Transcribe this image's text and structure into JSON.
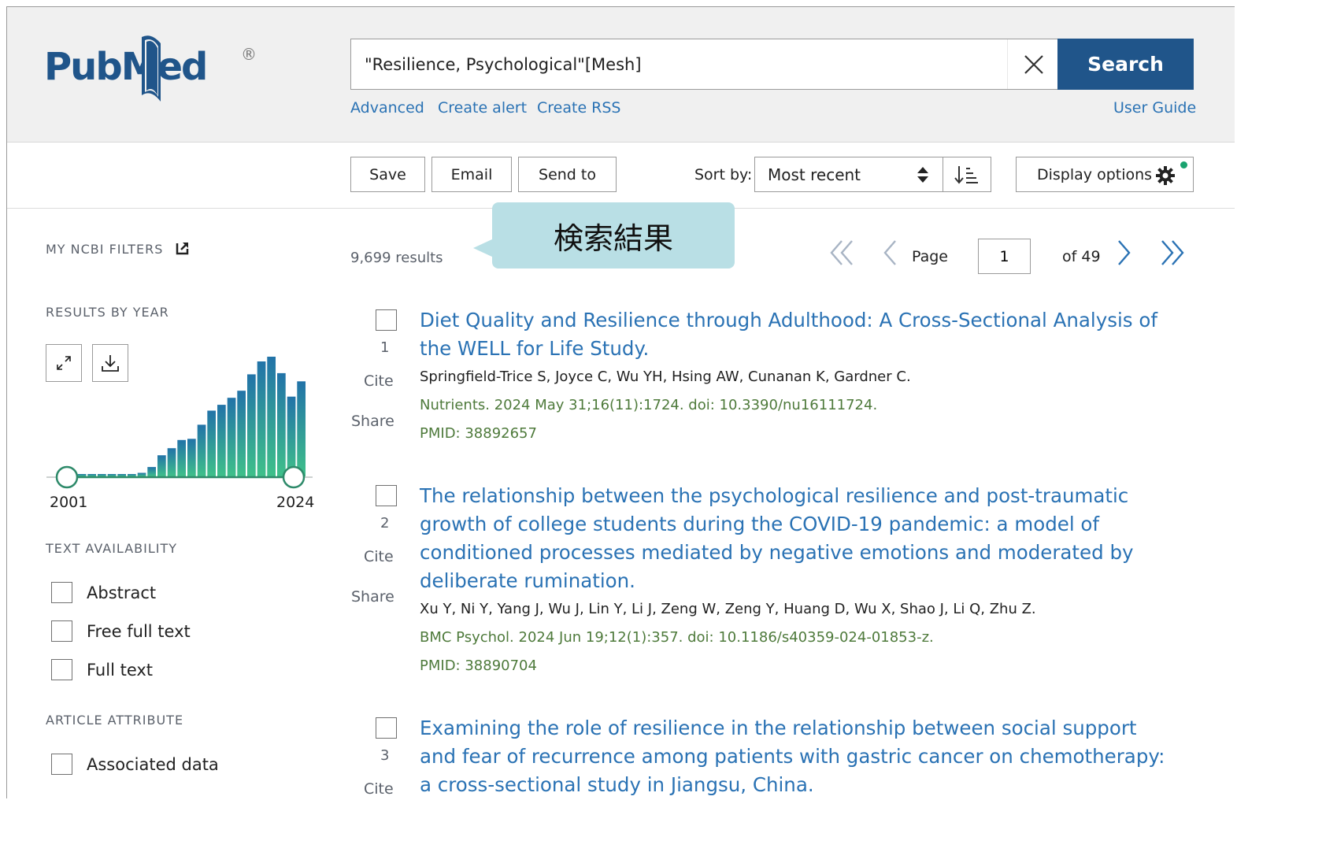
{
  "header": {
    "logo_text": "PubMed",
    "logo_reg": "®",
    "search_value": "\"Resilience, Psychological\"[Mesh]",
    "search_button": "Search",
    "links": [
      "Advanced",
      "Create alert",
      "Create RSS"
    ],
    "user_guide": "User Guide"
  },
  "toolbar": {
    "save": "Save",
    "email": "Email",
    "send_to": "Send to",
    "sort_label": "Sort by:",
    "sort_value": "Most recent",
    "display_options": "Display options"
  },
  "sidebar": {
    "my_ncbi_filters": "MY NCBI FILTERS",
    "results_by_year": "RESULTS BY YEAR",
    "year_start": "2001",
    "year_end": "2024",
    "text_availability": "TEXT AVAILABILITY",
    "text_filters": [
      "Abstract",
      "Free full text",
      "Full text"
    ],
    "article_attribute": "ARTICLE ATTRIBUTE",
    "attribute_filters": [
      "Associated data"
    ]
  },
  "chart_data": {
    "type": "bar",
    "categories": [
      "2001",
      "2002",
      "2003",
      "2004",
      "2005",
      "2006",
      "2007",
      "2008",
      "2009",
      "2010",
      "2011",
      "2012",
      "2013",
      "2014",
      "2015",
      "2016",
      "2017",
      "2018",
      "2019",
      "2020",
      "2021",
      "2022",
      "2023",
      "2024"
    ],
    "values": [
      2,
      2,
      2,
      2,
      2,
      2,
      2,
      3,
      8,
      18,
      24,
      31,
      32,
      44,
      56,
      61,
      67,
      73,
      87,
      98,
      102,
      88,
      68,
      81
    ],
    "xlabel": "",
    "ylabel": "",
    "grid": false
  },
  "results": {
    "count": "9,699 results",
    "page_label": "Page",
    "page_value": "1",
    "of_pages": "of 49",
    "cite": "Cite",
    "share": "Share",
    "items": [
      {
        "num": "1",
        "title": "Diet Quality and Resilience through Adulthood: A Cross-Sectional Analysis of the WELL for Life Study.",
        "authors": "Springfield-Trice S, Joyce C, Wu YH, Hsing AW, Cunanan K, Gardner C.",
        "citation": "Nutrients. 2024 May 31;16(11):1724. doi: 10.3390/nu16111724.",
        "pmid": "PMID: 38892657"
      },
      {
        "num": "2",
        "title": "The relationship between the psychological resilience and post-traumatic growth of college students during the COVID-19 pandemic: a model of conditioned processes mediated by negative emotions and moderated by deliberate rumination.",
        "authors": "Xu Y, Ni Y, Yang J, Wu J, Lin Y, Li J, Zeng W, Zeng Y, Huang D, Wu X, Shao J, Li Q, Zhu Z.",
        "citation": "BMC Psychol. 2024 Jun 19;12(1):357. doi: 10.1186/s40359-024-01853-z.",
        "pmid": "PMID: 38890704"
      },
      {
        "num": "3",
        "title": "Examining the role of resilience in the relationship between social support and fear of recurrence among patients with gastric cancer on chemotherapy: a cross-sectional study in Jiangsu, China.",
        "authors": "",
        "citation": "",
        "pmid": ""
      }
    ]
  },
  "annotation": {
    "callout": "検索結果"
  },
  "colors": {
    "brand": "#20558a",
    "link": "#2a72b4",
    "citation": "#4e7a3b",
    "callout_bg": "#b9dfe5"
  }
}
